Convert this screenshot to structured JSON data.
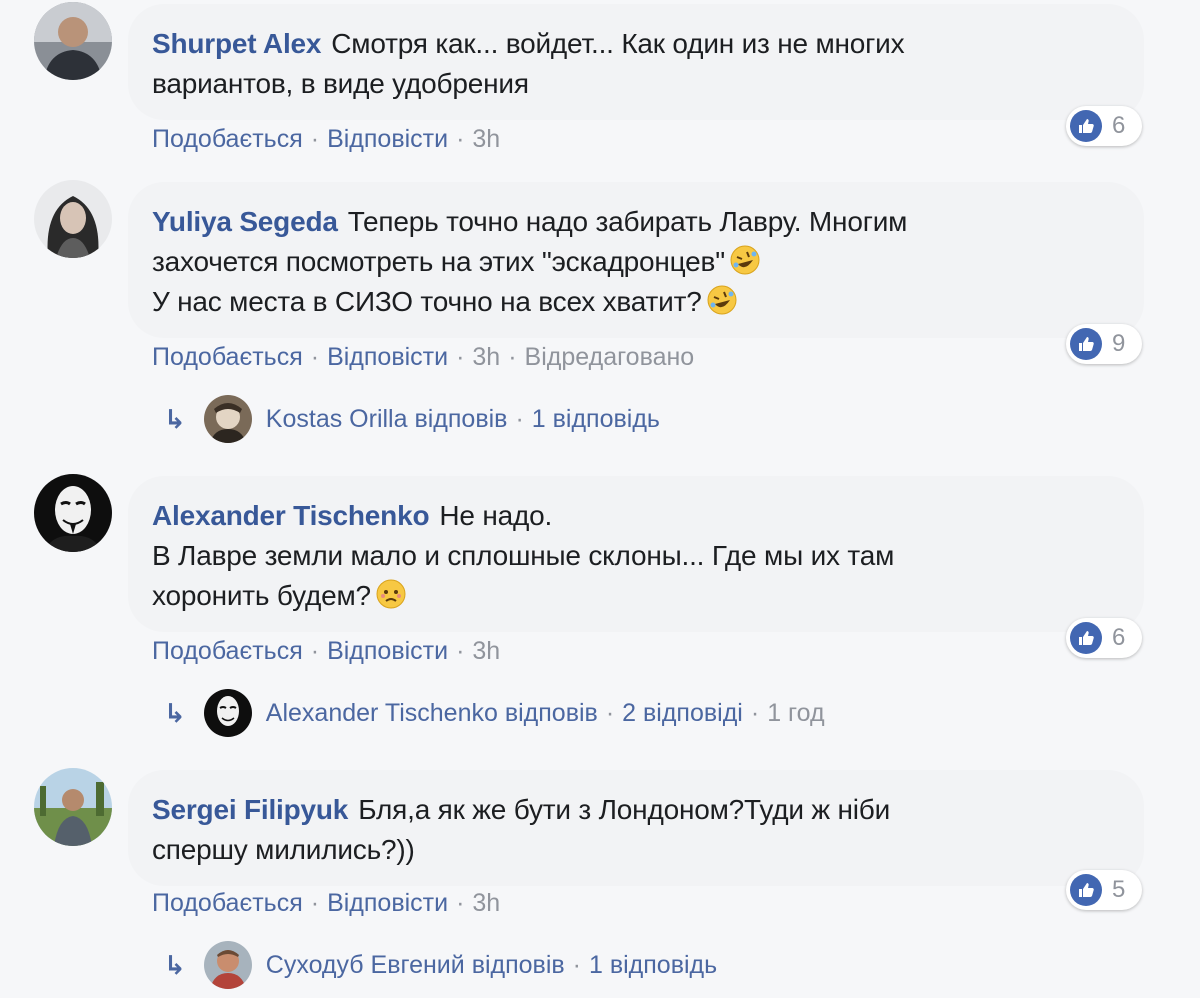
{
  "ui": {
    "like_label": "Подобається",
    "reply_label": "Відповісти",
    "replied_suffix": "відповів"
  },
  "comments": [
    {
      "author": "Shurpet Alex",
      "text_lines": [
        "Смотря как... войдет... Как один из не многих",
        "вариантов, в виде удобрения"
      ],
      "time": "3h",
      "likes": "6"
    },
    {
      "author": "Yuliya Segeda",
      "text_lines": [
        "Теперь точно надо забирать Лавру. Многим",
        "захочется посмотреть на этих \"эскадронцев\"",
        "У нас места в СИЗО точно на всех хватит?"
      ],
      "time": "3h",
      "edited": "Відредаговано",
      "likes": "9",
      "reply": {
        "name": "Kostas Orilla",
        "count": "1 відповідь"
      }
    },
    {
      "author": "Alexander Tischenko",
      "text_lines": [
        "Не надо.",
        "В Лавре земли мало и сплошные склоны... Где мы их там",
        "хоронить будем?"
      ],
      "time": "3h",
      "likes": "6",
      "reply": {
        "name": "Alexander Tischenko",
        "count": "2 відповіді",
        "time": "1 год"
      }
    },
    {
      "author": "Sergei Filipyuk",
      "text_lines": [
        "Бля,а як же бути з Лондоном?Туди ж ніби",
        "спершу милились?))"
      ],
      "time": "3h",
      "likes": "5",
      "reply": {
        "name": "Суходуб Евгений",
        "count": "1 відповідь"
      }
    }
  ],
  "icons": {
    "like": "thumbs-up-icon",
    "reply_arrow": "reply-arrow-icon",
    "emoji_laugh": "rolling-laughing-emoji",
    "emoji_sad": "sad-face-emoji"
  },
  "colors": {
    "author": "#385898",
    "link": "#4b67a1",
    "meta": "#90949c",
    "bubble": "#f2f3f5",
    "like_badge": "#4267b2"
  }
}
